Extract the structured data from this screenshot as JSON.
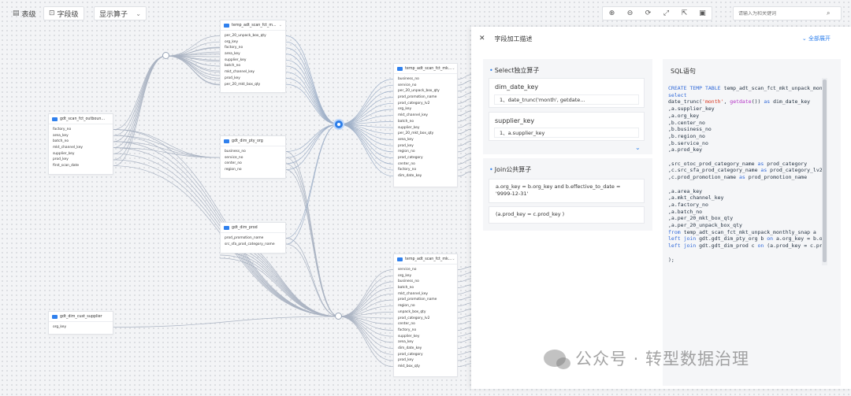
{
  "toolbar": {
    "table_level": "表级",
    "field_level": "字段级",
    "show_operator": "显示算子",
    "search_placeholder": "请输入为和关键词",
    "tool_icons": [
      "zoom-in-icon",
      "zoom-out-icon",
      "refresh-icon",
      "fullscreen-icon",
      "export-icon",
      "save-icon"
    ]
  },
  "tables": [
    {
      "id": "outbound",
      "title": "gdt_scan_fct_outboun...",
      "fields": [
        "factory_no",
        "area_key",
        "batch_no",
        "mkt_channel_key",
        "supplier_key",
        "prod_key",
        "first_scan_date"
      ]
    },
    {
      "id": "supplier",
      "title": "gdt_dim_cust_supplier",
      "fields": [
        "org_key"
      ]
    },
    {
      "id": "unpack",
      "title": "temp_adt_scan_fct_m...",
      "fields": [
        "per_20_unpack_box_qty",
        "org_key",
        "factory_no",
        "area_key",
        "supplier_key",
        "batch_no",
        "mkt_channel_key",
        "prod_key",
        "per_20_mkt_box_qty"
      ]
    },
    {
      "id": "pty",
      "title": "gdt_dim_pty_org",
      "fields": [
        "business_no",
        "service_no",
        "center_no",
        "region_no"
      ]
    },
    {
      "id": "prod",
      "title": "gdt_dim_prod",
      "fields": [
        "prod_promotion_name",
        "src_sfa_prod_category_name"
      ]
    },
    {
      "id": "mid",
      "title": "temp_adt_scan_fct_mk...",
      "fields": [
        "business_no",
        "service_no",
        "per_20_unpack_box_qty",
        "prod_promotion_name",
        "prod_category_lv2",
        "org_key",
        "mkt_channel_key",
        "batch_no",
        "supplier_key",
        "per_20_mkt_box_qty",
        "area_key",
        "prod_key",
        "region_no",
        "prod_category",
        "center_no",
        "factory_no",
        "dim_date_key"
      ]
    },
    {
      "id": "bottom",
      "title": "temp_adt_scan_fct_mk...",
      "fields": [
        "service_no",
        "org_key",
        "business_no",
        "batch_no",
        "mkt_channel_key",
        "prod_promotion_name",
        "region_no",
        "unpack_box_qty",
        "prod_category_lv2",
        "center_no",
        "factory_no",
        "supplier_key",
        "area_key",
        "dim_date_key",
        "prod_category",
        "prod_key",
        "mkt_box_qty"
      ]
    }
  ],
  "panel": {
    "title": "字段加工描述",
    "expand_all": "全部展开",
    "select_section": {
      "title": "Select独立算子",
      "items": [
        {
          "name": "dim_date_key",
          "value": "1、date_trunc('month', getdate..."
        },
        {
          "name": "supplier_key",
          "value": "1、a.supplier_key"
        }
      ]
    },
    "join_section": {
      "title": "Join公共算子",
      "items": [
        "a.org_key = b.org_key and b.effective_to_date = '9999-12-31'",
        "(a.prod_key = c.prod_key )"
      ]
    },
    "sql_section": {
      "title": "SQL语句"
    }
  },
  "watermark": "公众号 · 转型数据治理"
}
